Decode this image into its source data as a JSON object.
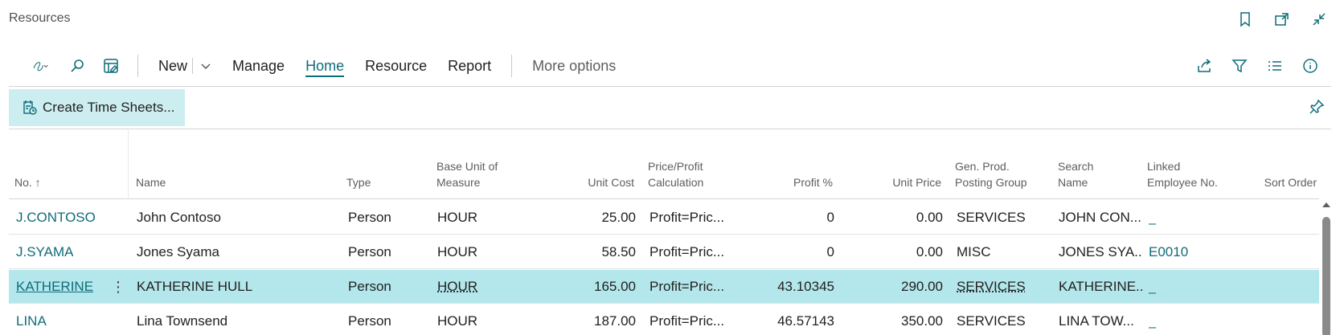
{
  "page": {
    "title": "Resources"
  },
  "menu": {
    "new": "New",
    "manage": "Manage",
    "home": "Home",
    "resource": "Resource",
    "report": "Report",
    "more": "More options"
  },
  "promoted": {
    "create_time_sheets": "Create Time Sheets..."
  },
  "columns": {
    "no": "No. ↑",
    "name": "Name",
    "type": "Type",
    "base_unit_1": "Base Unit of",
    "base_unit_2": "Measure",
    "unit_cost": "Unit Cost",
    "price_calc_1": "Price/Profit",
    "price_calc_2": "Calculation",
    "profit_pct": "Profit %",
    "unit_price": "Unit Price",
    "gen_prod_1": "Gen. Prod.",
    "gen_prod_2": "Posting Group",
    "search_1": "Search",
    "search_2": "Name",
    "linked_1": "Linked",
    "linked_2": "Employee No.",
    "sort_order": "Sort Order"
  },
  "rows": [
    {
      "no": "J.CONTOSO",
      "name": "John Contoso",
      "type": "Person",
      "uom": "HOUR",
      "unit_cost": "25.00",
      "calc": "Profit=Pric...",
      "profit": "0",
      "unit_price": "0.00",
      "gpg": "SERVICES",
      "search": "JOHN CON...",
      "linked": "_"
    },
    {
      "no": "J.SYAMA",
      "name": "Jones Syama",
      "type": "Person",
      "uom": "HOUR",
      "unit_cost": "58.50",
      "calc": "Profit=Pric...",
      "profit": "0",
      "unit_price": "0.00",
      "gpg": "MISC",
      "search": "JONES SYA...",
      "linked": "E0010"
    },
    {
      "no": "KATHERINE",
      "name": "KATHERINE HULL",
      "type": "Person",
      "uom": "HOUR",
      "unit_cost": "165.00",
      "calc": "Profit=Pric...",
      "profit": "43.10345",
      "unit_price": "290.00",
      "gpg": "SERVICES",
      "search": "KATHERINE...",
      "linked": "_",
      "row_menu": "⋮"
    },
    {
      "no": "LINA",
      "name": "Lina Townsend",
      "type": "Person",
      "uom": "HOUR",
      "unit_cost": "187.00",
      "calc": "Profit=Pric...",
      "profit": "46.57143",
      "unit_price": "350.00",
      "gpg": "SERVICES",
      "search": "LINA TOW...",
      "linked": "_"
    }
  ],
  "colors": {
    "accent": "#0f6c7a",
    "selected_row": "#b3e7eb",
    "promo_bg": "#cdeef0"
  }
}
